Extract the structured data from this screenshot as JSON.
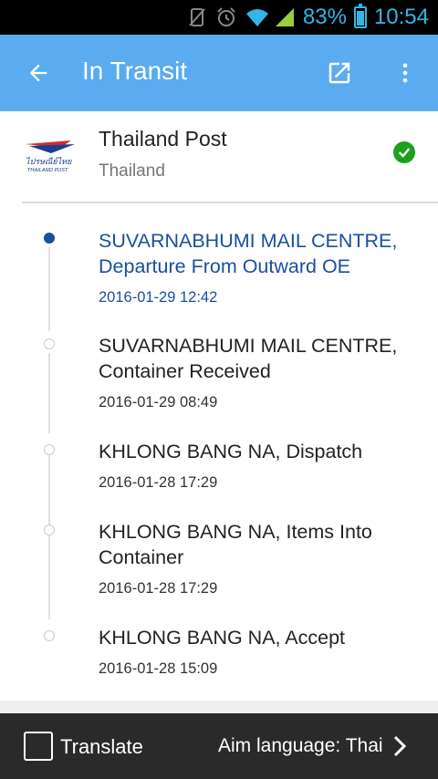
{
  "status_bar": {
    "battery_percent": "83%",
    "time": "10:54",
    "icons": [
      "no-sim-icon",
      "alarm-icon",
      "wifi-icon",
      "signal-icon",
      "battery-icon"
    ]
  },
  "app_bar": {
    "title": "In Transit",
    "background_color": "#5aabf0",
    "icons": [
      "back-arrow-icon",
      "open-external-icon",
      "more-vert-icon"
    ]
  },
  "carrier": {
    "name": "Thailand Post",
    "country": "Thailand",
    "logo_text": "ไปรษณีย์ไทย THAILAND POST",
    "status_icon": "check-circle-icon",
    "status_color": "#1ea01e"
  },
  "events": [
    {
      "location": "SUVARNABHUMI MAIL CENTRE, Departure From Outward OE",
      "datetime": "2016-01-29 12:42",
      "active": true
    },
    {
      "location": "SUVARNABHUMI MAIL CENTRE, Container Received",
      "datetime": "2016-01-29 08:49",
      "active": false
    },
    {
      "location": "KHLONG BANG NA, Dispatch",
      "datetime": "2016-01-28 17:29",
      "active": false
    },
    {
      "location": "KHLONG BANG NA, Items Into Container",
      "datetime": "2016-01-28 17:29",
      "active": false
    },
    {
      "location": "KHLONG BANG NA, Accept",
      "datetime": "2016-01-28 15:09",
      "active": false
    }
  ],
  "active_color": "#1a4fa0",
  "bottom_bar": {
    "translate_label": "Translate",
    "translate_checked": false,
    "aim_language_label": "Aim language: Thai"
  }
}
